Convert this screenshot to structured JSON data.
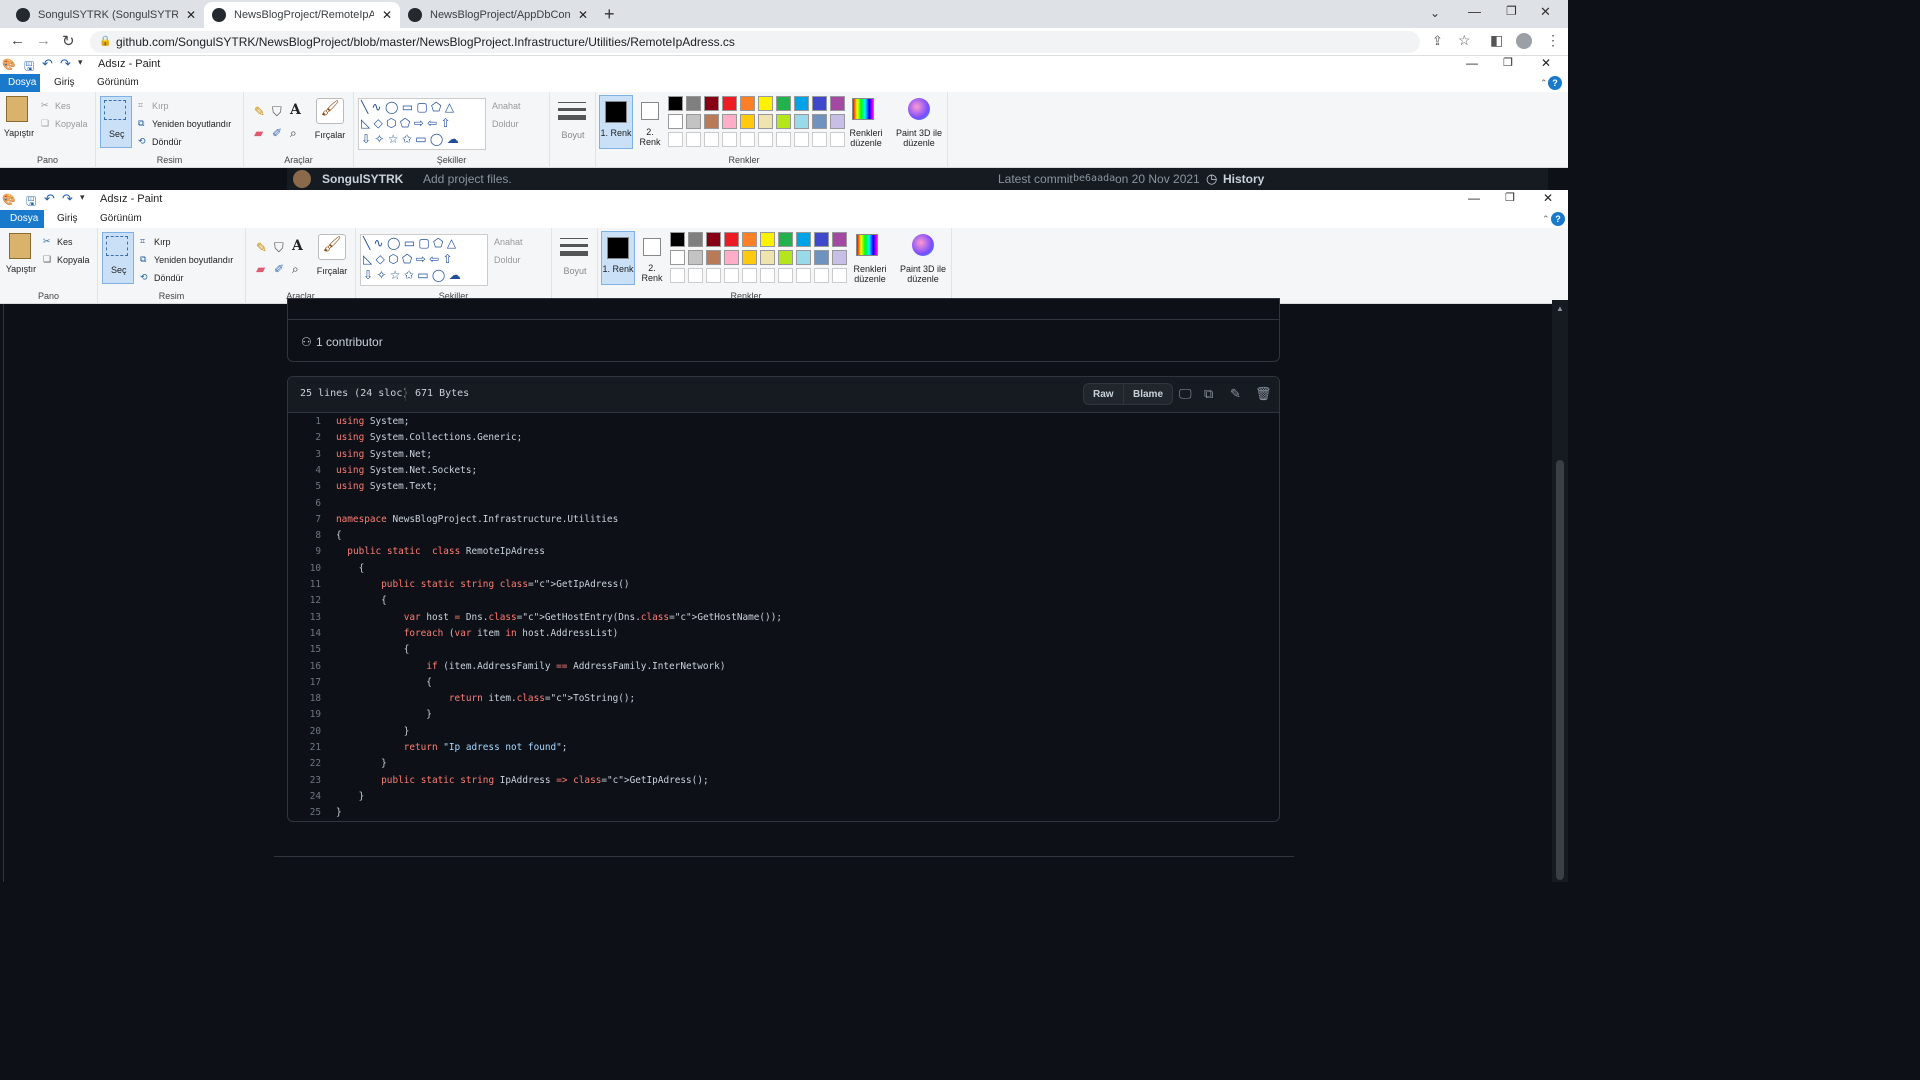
{
  "browser": {
    "tabs": [
      {
        "title": "SongulSYTRK (SongulSYTRK) / Re",
        "active": false
      },
      {
        "title": "NewsBlogProject/RemoteIpAdress",
        "active": true
      },
      {
        "title": "NewsBlogProject/AppDbContext",
        "active": false
      }
    ],
    "url": "github.com/SongulSYTRK/NewsBlogProject/blob/master/NewsBlogProject.Infrastructure/Utilities/RemoteIpAdress.cs",
    "new_tab": "+"
  },
  "paint": {
    "title": "Adsız - Paint",
    "tabs": {
      "file": "Dosya",
      "home": "Giriş",
      "view": "Görünüm"
    },
    "clipboard": {
      "paste": "Yapıştır",
      "cut": "Kes",
      "copy": "Kopyala",
      "label": "Pano"
    },
    "image": {
      "select": "Seç",
      "crop": "Kırp",
      "resize": "Yeniden boyutlandır",
      "rotate": "Döndür",
      "label": "Resim"
    },
    "tools": {
      "brushes": "Fırçalar",
      "label": "Araçlar",
      "text_icon": "A"
    },
    "shapes": {
      "outline": "Anahat",
      "fill": "Doldur",
      "label": "Şekiller"
    },
    "size": "Boyut",
    "color1": "1. Renk",
    "color2": "2. Renk",
    "colors_label": "Renkler",
    "edit_colors": "Renkleri düzenle",
    "paint3d": "Paint 3D ile düzenle",
    "palette_row1": [
      "#000000",
      "#7f7f7f",
      "#880015",
      "#ed1c24",
      "#ff7f27",
      "#fff200",
      "#22b14c",
      "#00a2e8",
      "#3f48cc",
      "#a349a4"
    ],
    "palette_row2": [
      "#ffffff",
      "#c3c3c3",
      "#b97a57",
      "#ffaec9",
      "#ffc90e",
      "#efe4b0",
      "#b5e61d",
      "#99d9ea",
      "#7092be",
      "#c8bfe7"
    ],
    "palette_row3": [
      "#ffffff",
      "#ffffff",
      "#ffffff",
      "#ffffff",
      "#ffffff",
      "#ffffff",
      "#ffffff",
      "#ffffff",
      "#ffffff",
      "#ffffff"
    ]
  },
  "github": {
    "author": "SongulSYTRK",
    "commit_message": "Add project files.",
    "latest_commit_label": "Latest commit",
    "commit_hash": "be6aada",
    "commit_date": "on 20 Nov 2021",
    "history": "History",
    "contributors": "1 contributor",
    "file_lines": "25 lines (24 sloc)",
    "file_size": "671 Bytes",
    "raw": "Raw",
    "blame": "Blame",
    "code": [
      "using System;",
      "using System.Collections.Generic;",
      "using System.Net;",
      "using System.Net.Sockets;",
      "using System.Text;",
      "",
      "namespace NewsBlogProject.Infrastructure.Utilities",
      "{",
      "  public static  class RemoteIpAdress",
      "    {",
      "        public static string GetIpAdress()",
      "        {",
      "            var host = Dns.GetHostEntry(Dns.GetHostName());",
      "            foreach (var item in host.AddressList)",
      "            {",
      "                if (item.AddressFamily == AddressFamily.InterNetwork)",
      "                {",
      "                    return item.ToString();",
      "                }",
      "            }",
      "            return \"Ip adress not found\";",
      "        }",
      "        public static string IpAddress => GetIpAdress();",
      "    }",
      "}"
    ]
  }
}
